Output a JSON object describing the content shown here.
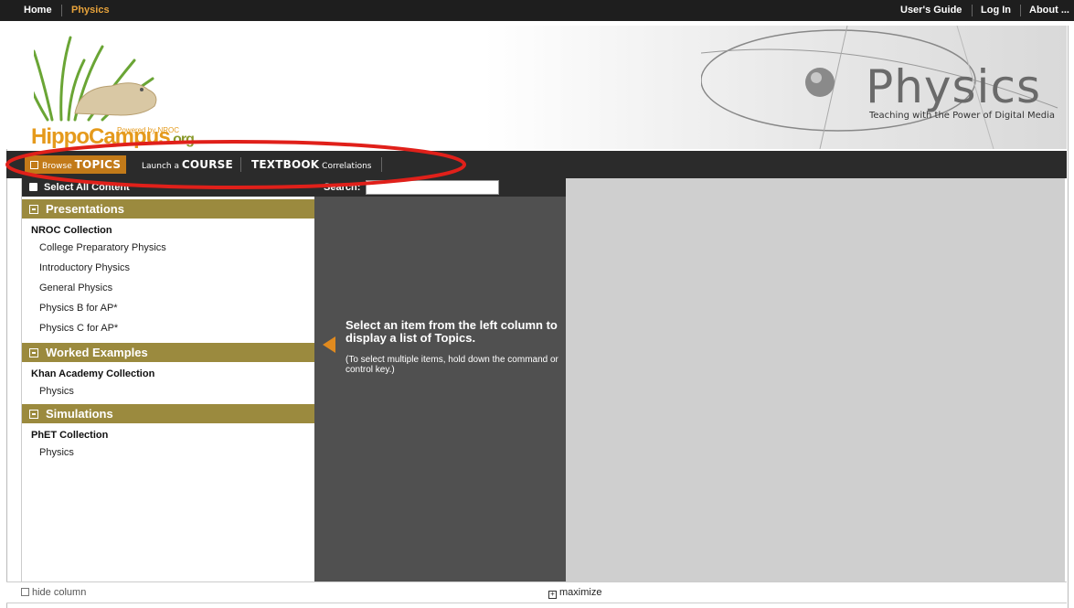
{
  "topbar": {
    "home": "Home",
    "physics": "Physics",
    "users_guide": "User's Guide",
    "log_in": "Log In",
    "about": "About ..."
  },
  "header": {
    "logo_main": "HippoCampus",
    "logo_org": ".org",
    "powered": "Powered by NROC",
    "title": "Physics",
    "tagline": "Teaching with the Power of Digital Media"
  },
  "nav": {
    "browse_small": "Browse",
    "browse_big": "TOPICS",
    "launch_small": "Launch a",
    "launch_big": "COURSE",
    "textbook_big": "TEXTBOOK",
    "textbook_small": "Correlations"
  },
  "left": {
    "select_all": "Select All Content",
    "sections": [
      {
        "title": "Presentations",
        "group": "NROC Collection",
        "items": [
          "College Preparatory Physics",
          "Introductory Physics",
          "General Physics",
          "Physics B for AP*",
          "Physics C for AP*"
        ]
      },
      {
        "title": "Worked Examples",
        "group": "Khan Academy Collection",
        "items": [
          "Physics"
        ]
      },
      {
        "title": "Simulations",
        "group": "PhET Collection",
        "items": [
          "Physics"
        ]
      }
    ]
  },
  "middle": {
    "search_label": "Search:",
    "search_value": "",
    "message": "Select an item from the left column to display a list of Topics.",
    "hint": "(To select multiple items, hold down the command or control key.)"
  },
  "footer": {
    "hide_column": "hide column",
    "maximize": "maximize"
  },
  "colors": {
    "accent": "#c27a19",
    "section": "#9b8a3e",
    "dark": "#2b2b2b",
    "annotation": "#e0201a"
  }
}
